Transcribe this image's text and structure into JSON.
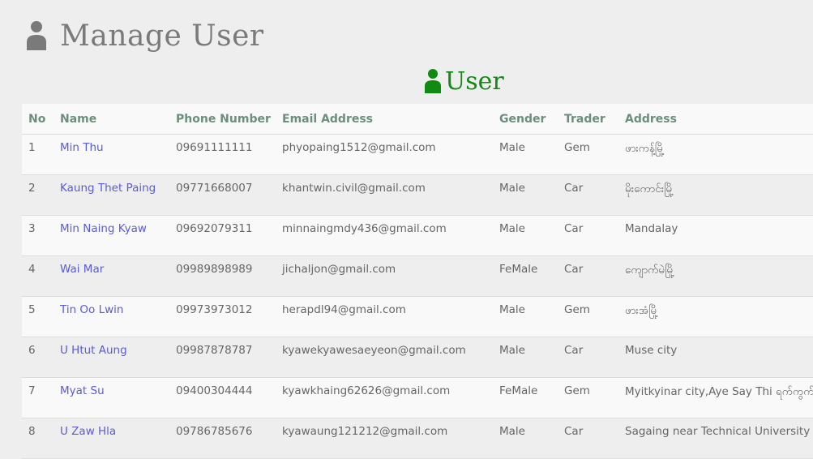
{
  "header": {
    "title": "Manage User",
    "icon": "user-icon",
    "icon_color": "#7a7a7a"
  },
  "section": {
    "title": "User",
    "icon": "user-icon",
    "color": "#108a10"
  },
  "table": {
    "columns": [
      "No",
      "Name",
      "Phone Number",
      "Email Address",
      "Gender",
      "Trader",
      "Address"
    ],
    "rows": [
      {
        "no": "1",
        "name": "Min Thu",
        "phone": "09691111111",
        "email": "phyopaing1512@gmail.com",
        "gender": "Male",
        "trader": "Gem",
        "address": "ဖားကန့်မြို့"
      },
      {
        "no": "2",
        "name": "Kaung Thet Paing",
        "phone": "09771668007",
        "email": "khantwin.civil@gmail.com",
        "gender": "Male",
        "trader": "Car",
        "address": "မိုးကောင်းမြို့"
      },
      {
        "no": "3",
        "name": "Min Naing Kyaw",
        "phone": "09692079311",
        "email": "minnaingmdy436@gmail.com",
        "gender": "Male",
        "trader": "Car",
        "address": "Mandalay"
      },
      {
        "no": "4",
        "name": "Wai Mar",
        "phone": "09989898989",
        "email": "jichaljon@gmail.com",
        "gender": "FeMale",
        "trader": "Car",
        "address": " ကျောက်မဲမြို့"
      },
      {
        "no": "5",
        "name": "Tin Oo Lwin",
        "phone": "09973973012",
        "email": "herapdl94@gmail.com",
        "gender": "Male",
        "trader": "Gem",
        "address": "ဖားအံမြို့"
      },
      {
        "no": "6",
        "name": "U Htut Aung",
        "phone": "09987878787",
        "email": "kyawekyawesaeyeon@gmail.com",
        "gender": "Male",
        "trader": "Car",
        "address": "Muse city"
      },
      {
        "no": "7",
        "name": "Myat Su",
        "phone": "09400304444",
        "email": "kyawkhaing62626@gmail.com",
        "gender": "FeMale",
        "trader": "Gem",
        "address": "Myitkyinar city,Aye Say Thi ရက်ကွက်"
      },
      {
        "no": "8",
        "name": "U Zaw Hla",
        "phone": "09786785676",
        "email": "kyawaung121212@gmail.com",
        "gender": "Male",
        "trader": "Car",
        "address": "Sagaing near Technical University"
      }
    ]
  }
}
